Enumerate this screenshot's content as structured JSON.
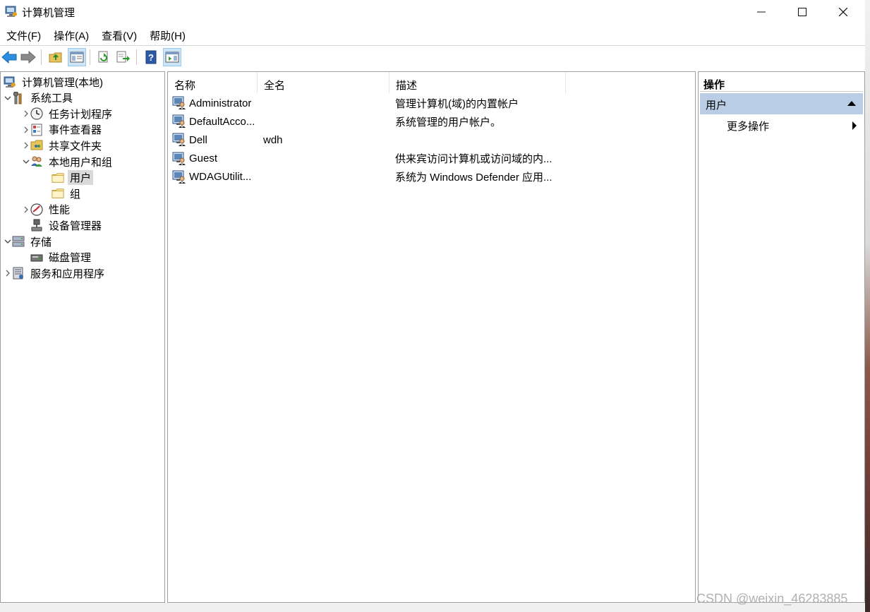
{
  "window": {
    "title": "计算机管理"
  },
  "menu": [
    "文件(F)",
    "操作(A)",
    "查看(V)",
    "帮助(H)"
  ],
  "tree": [
    {
      "label": "计算机管理(本地)",
      "icon": "computer-management-icon",
      "level": 0,
      "expander": "none"
    },
    {
      "label": "系统工具",
      "icon": "system-tools-icon",
      "level": 0,
      "expander": "expanded"
    },
    {
      "label": "任务计划程序",
      "icon": "clock-icon",
      "level": 1,
      "expander": "collapsed"
    },
    {
      "label": "事件查看器",
      "icon": "event-viewer-icon",
      "level": 1,
      "expander": "collapsed"
    },
    {
      "label": "共享文件夹",
      "icon": "shared-folder-icon",
      "level": 1,
      "expander": "collapsed"
    },
    {
      "label": "本地用户和组",
      "icon": "users-group-icon",
      "level": 1,
      "expander": "expanded"
    },
    {
      "label": "用户",
      "icon": "folder-icon",
      "level": 2,
      "expander": "none",
      "selected": true
    },
    {
      "label": "组",
      "icon": "folder-icon",
      "level": 2,
      "expander": "none"
    },
    {
      "label": "性能",
      "icon": "performance-icon",
      "level": 1,
      "expander": "collapsed"
    },
    {
      "label": "设备管理器",
      "icon": "device-manager-icon",
      "level": 1,
      "expander": "none"
    },
    {
      "label": "存储",
      "icon": "storage-icon",
      "level": 0,
      "expander": "expanded"
    },
    {
      "label": "磁盘管理",
      "icon": "disk-management-icon",
      "level": 1,
      "expander": "none"
    },
    {
      "label": "服务和应用程序",
      "icon": "services-icon",
      "level": 0,
      "expander": "collapsed"
    }
  ],
  "list": {
    "columns": [
      "名称",
      "全名",
      "描述"
    ],
    "rows": [
      {
        "name": "Administrator",
        "fullname": "",
        "desc": "管理计算机(域)的内置帐户"
      },
      {
        "name": "DefaultAcco...",
        "fullname": "",
        "desc": "系统管理的用户帐户。"
      },
      {
        "name": "Dell",
        "fullname": "wdh",
        "desc": ""
      },
      {
        "name": "Guest",
        "fullname": "",
        "desc": "供来宾访问计算机或访问域的内..."
      },
      {
        "name": "WDAGUtilit...",
        "fullname": "",
        "desc": "系统为 Windows Defender 应用..."
      }
    ]
  },
  "actions": {
    "title": "操作",
    "section": "用户",
    "more": "更多操作"
  },
  "watermark": "CSDN @weixin_46283885",
  "colors": {
    "selection": "#b9cde5",
    "tree_selected": "#d9d9d9",
    "accent": "#1e73be"
  }
}
